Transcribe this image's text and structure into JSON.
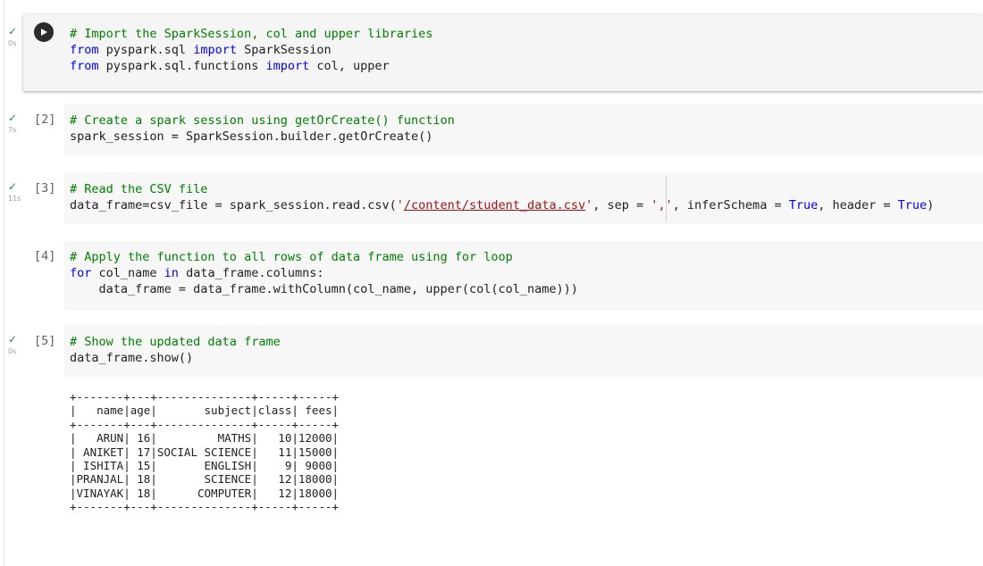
{
  "cells": [
    {
      "check": "✓",
      "time": "0s",
      "count": "",
      "lines": [
        [
          {
            "t": "# Import the SparkSession, col and upper libraries",
            "c": "cmt"
          }
        ],
        [
          {
            "t": "from",
            "c": "kw"
          },
          {
            "t": " pyspark.sql ",
            "c": ""
          },
          {
            "t": "import",
            "c": "kw"
          },
          {
            "t": " SparkSession",
            "c": ""
          }
        ],
        [
          {
            "t": "from",
            "c": "kw"
          },
          {
            "t": " pyspark.sql.functions ",
            "c": ""
          },
          {
            "t": "import",
            "c": "kw"
          },
          {
            "t": " col, upper",
            "c": ""
          }
        ]
      ]
    },
    {
      "check": "✓",
      "time": "7s",
      "count": "[2]",
      "lines": [
        [
          {
            "t": "# Create a spark session using getOrCreate() function",
            "c": "cmt"
          }
        ],
        [
          {
            "t": "spark_session = SparkSession.builder.getOrCreate()",
            "c": ""
          }
        ]
      ]
    },
    {
      "check": "✓",
      "time": "11s",
      "count": "[3]",
      "lines": [
        [
          {
            "t": "# Read the CSV file",
            "c": "cmt"
          }
        ],
        [
          {
            "t": "data_frame=csv_file = spark_session.read.csv(",
            "c": ""
          },
          {
            "t": "'",
            "c": "str"
          },
          {
            "t": "/content/student_data.csv",
            "c": "link"
          },
          {
            "t": "'",
            "c": "str"
          },
          {
            "t": ", sep = ",
            "c": ""
          },
          {
            "t": "','",
            "c": "str"
          },
          {
            "t": ", inferSchema = ",
            "c": ""
          },
          {
            "t": "True",
            "c": "kw"
          },
          {
            "t": ", header = ",
            "c": ""
          },
          {
            "t": "True",
            "c": "kw"
          },
          {
            "t": ")",
            "c": ""
          }
        ]
      ]
    },
    {
      "check": "",
      "time": "",
      "count": "[4]",
      "lines": [
        [
          {
            "t": "# Apply the function to all rows of data frame using for loop",
            "c": "cmt"
          }
        ],
        [
          {
            "t": "for",
            "c": "kw"
          },
          {
            "t": " col_name ",
            "c": ""
          },
          {
            "t": "in",
            "c": "kw"
          },
          {
            "t": " data_frame.columns:",
            "c": ""
          }
        ],
        [
          {
            "t": "    data_frame = data_frame.withColumn(col_name, upper(col(col_name)))",
            "c": ""
          }
        ]
      ]
    },
    {
      "check": "✓",
      "time": "0s",
      "count": "[5]",
      "lines": [
        [
          {
            "t": "# Show the updated data frame",
            "c": "cmt"
          }
        ],
        [
          {
            "t": "data_frame.show()",
            "c": ""
          }
        ]
      ]
    }
  ],
  "output": {
    "lines": [
      "+-------+---+--------------+-----+-----+",
      "|   name|age|       subject|class| fees|",
      "+-------+---+--------------+-----+-----+",
      "|   ARUN| 16|         MATHS|   10|12000|",
      "| ANIKET| 17|SOCIAL SCIENCE|   11|15000|",
      "| ISHITA| 15|       ENGLISH|    9| 9000|",
      "|PRANJAL| 18|       SCIENCE|   12|18000|",
      "|VINAYAK| 18|      COMPUTER|   12|18000|",
      "+-------+---+--------------+-----+-----+"
    ]
  }
}
